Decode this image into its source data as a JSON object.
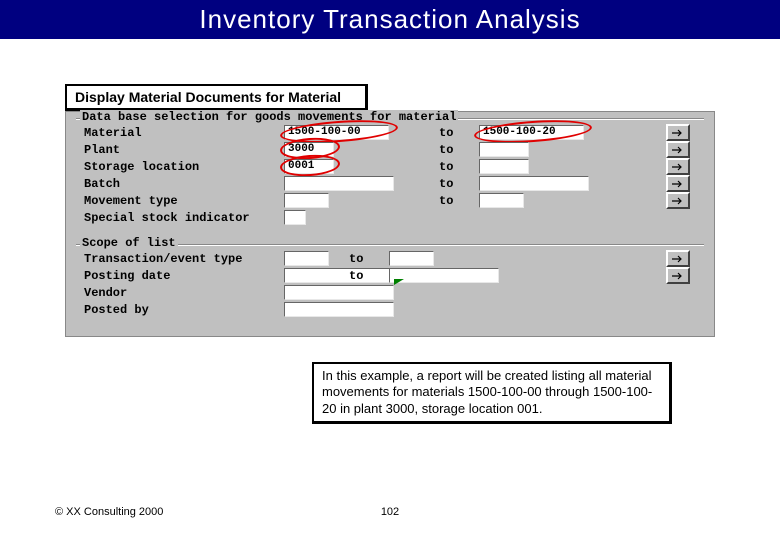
{
  "title": "Inventory Transaction Analysis",
  "window_title": "Display Material Documents for Material",
  "group1": {
    "label": "Data base selection for goods movements for material",
    "rows": {
      "material": {
        "label": "Material",
        "from": "1500-100-00",
        "to_label": "to",
        "to": "1500-100-20"
      },
      "plant": {
        "label": "Plant",
        "from": "3000",
        "to_label": "to",
        "to": ""
      },
      "sloc": {
        "label": "Storage location",
        "from": "0001",
        "to_label": "to",
        "to": ""
      },
      "batch": {
        "label": "Batch",
        "from": "",
        "to_label": "to",
        "to": ""
      },
      "mvt": {
        "label": "Movement type",
        "from": "",
        "to_label": "to",
        "to": ""
      },
      "ssi": {
        "label": "Special stock indicator",
        "from": ""
      }
    }
  },
  "group2": {
    "label": "Scope of list",
    "rows": {
      "tet": {
        "label": "Transaction/event type",
        "from": "",
        "to_label": "to",
        "to": ""
      },
      "pdate": {
        "label": "Posting date",
        "from": "",
        "to_label": "to",
        "to": ""
      },
      "vendor": {
        "label": "Vendor",
        "from": ""
      },
      "postedby": {
        "label": "Posted by",
        "from": ""
      }
    }
  },
  "note": "In this example, a report will be created listing all material movements for materials 1500-100-00 through 1500-100-20 in plant 3000, storage location 001.",
  "footer": {
    "copyright": "© XX Consulting 2000",
    "page": "102"
  }
}
